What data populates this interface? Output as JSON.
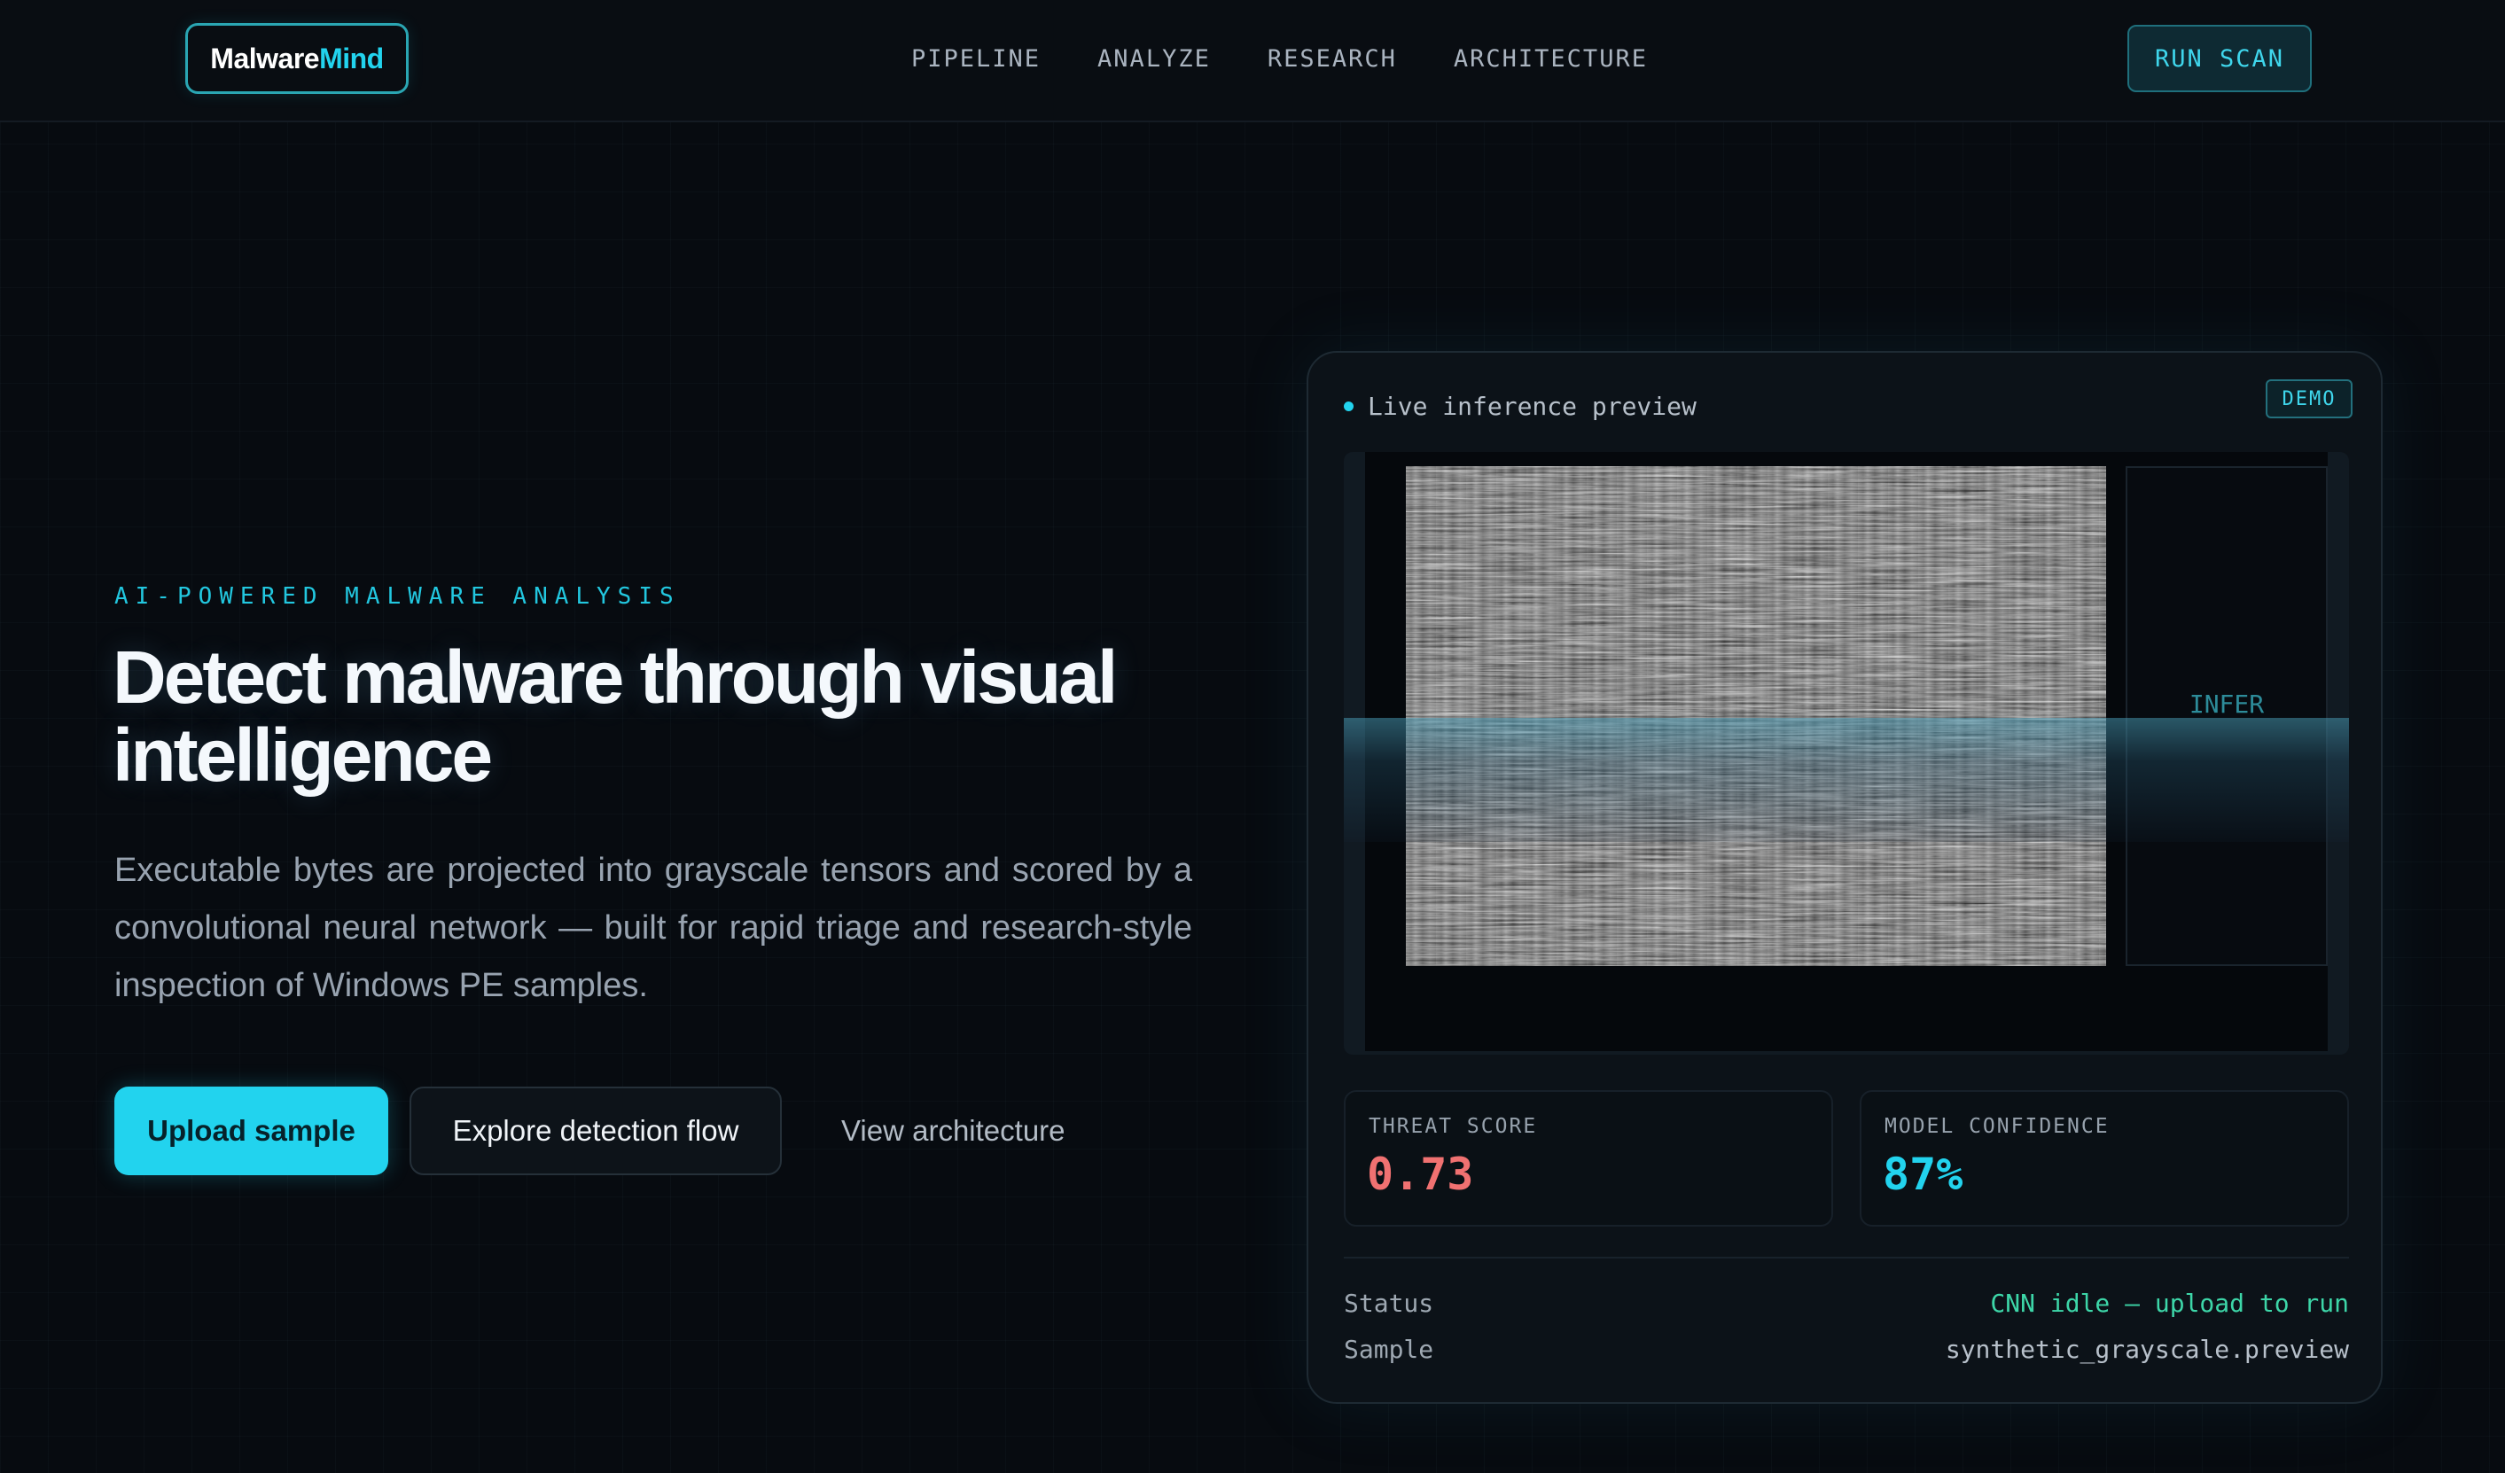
{
  "brand": {
    "name_part1": "Malware",
    "name_part2": "Mind"
  },
  "nav": {
    "links": [
      "PIPELINE",
      "ANALYZE",
      "RESEARCH",
      "ARCHITECTURE"
    ],
    "cta": "RUN SCAN"
  },
  "hero": {
    "eyebrow": "AI-POWERED MALWARE ANALYSIS",
    "title_line1": "Detect malware through visual",
    "title_line2": "intelligence",
    "lead": "Executable bytes are projected into grayscale tensors and scored by a convolutional neural network — built for rapid triage and research-style inspection of Windows PE samples.",
    "buttons": {
      "primary": "Upload sample",
      "secondary": "Explore detection flow",
      "link": "View architecture"
    }
  },
  "panel": {
    "title": "Live inference preview",
    "badge": "DEMO",
    "infer_label": "INFER",
    "metrics": {
      "threat_label": "THREAT SCORE",
      "threat_value": "0.73",
      "confidence_label": "MODEL CONFIDENCE",
      "confidence_value": "87%"
    },
    "status_label": "Status",
    "status_value": "CNN idle — upload to run",
    "sample_label": "Sample",
    "sample_value": "synthetic_grayscale.preview"
  },
  "colors": {
    "accent": "#22d3ee",
    "threat": "#f07171",
    "status_ok": "#3dd6a8",
    "background": "#070b10"
  }
}
